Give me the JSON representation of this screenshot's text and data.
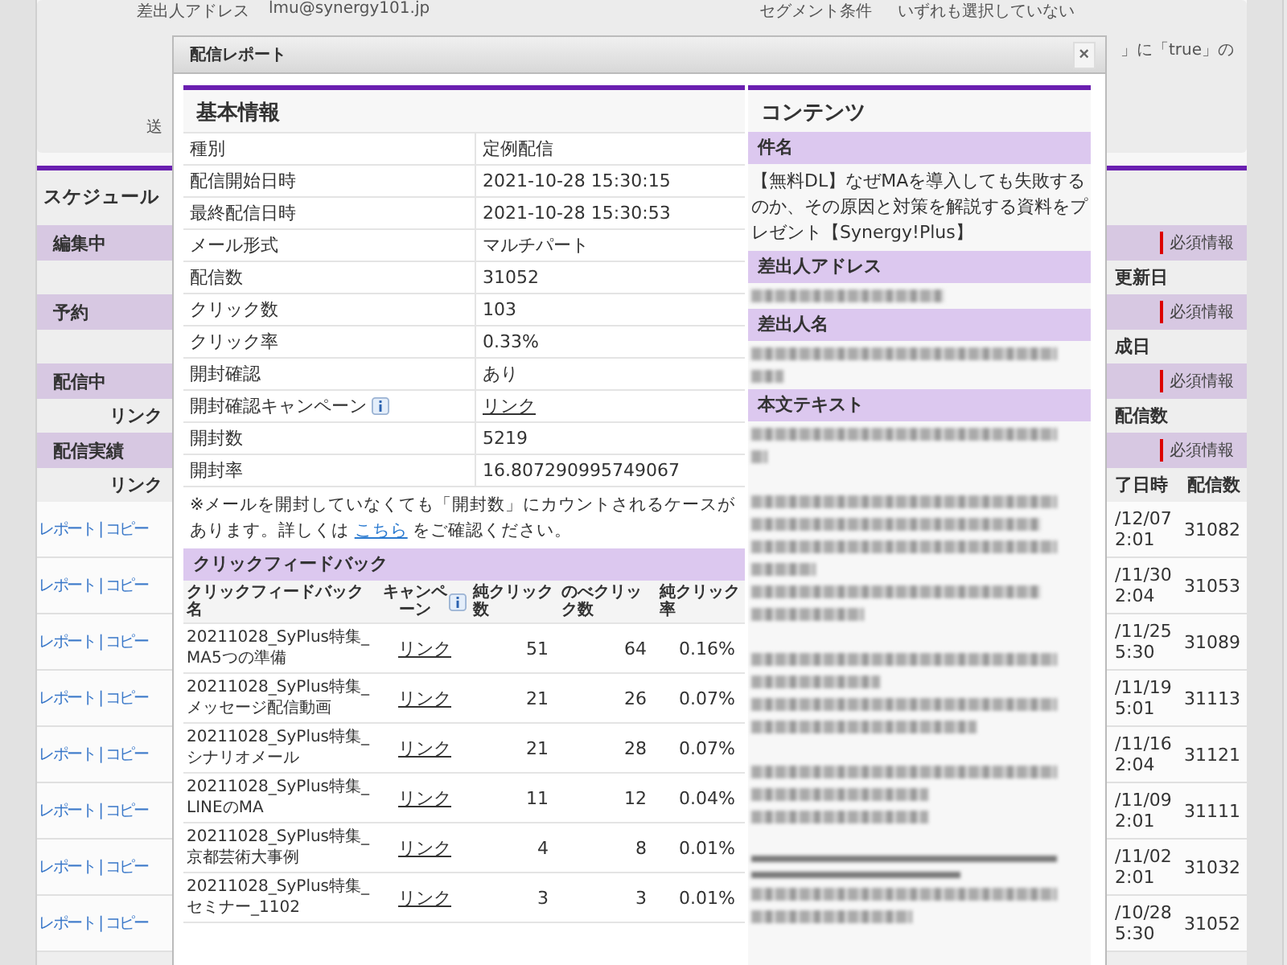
{
  "background": {
    "header_fields": [
      {
        "label": "差出人アドレス",
        "value": "lmu@synergy101.jp"
      },
      {
        "label": "セグメント条件",
        "value": "いずれも選択していない"
      }
    ],
    "condition_fragment": "」に「true」の",
    "label_fragment": "送",
    "schedule": {
      "title": "スケジュール",
      "sections": [
        {
          "name": "編集中",
          "badge": "必須情報",
          "header": {
            "date": "更新日"
          }
        },
        {
          "name": "予約",
          "badge": "必須情報",
          "header": {
            "date": "成日"
          }
        },
        {
          "name": "配信中",
          "badge": "必須情報",
          "header": {
            "left": "リンク",
            "date": "配信数"
          }
        },
        {
          "name": "配信実績",
          "badge": "必須情報",
          "header": {
            "left": "リンク",
            "date": "了日時",
            "count": "配信数"
          },
          "rows": [
            {
              "link": "レポート | コピー",
              "date": "/12/07",
              "time": "2:01",
              "count": "31082"
            },
            {
              "link": "レポート | コピー",
              "date": "/11/30",
              "time": "2:04",
              "count": "31053"
            },
            {
              "link": "レポート | コピー",
              "date": "/11/25",
              "time": "5:30",
              "count": "31089"
            },
            {
              "link": "レポート | コピー",
              "date": "/11/19",
              "time": "5:01",
              "count": "31113"
            },
            {
              "link": "レポート | コピー",
              "date": "/11/16",
              "time": "2:04",
              "count": "31121"
            },
            {
              "link": "レポート | コピー",
              "date": "/11/09",
              "time": "2:01",
              "count": "31111"
            },
            {
              "link": "レポート | コピー",
              "date": "/11/02",
              "time": "2:01",
              "count": "31032"
            },
            {
              "link": "レポート | コピー",
              "date": "/10/28",
              "time": "5:30",
              "count": "31052"
            }
          ]
        }
      ]
    }
  },
  "modal": {
    "title": "配信レポート",
    "close": "×",
    "basic": {
      "title": "基本情報",
      "rows": [
        {
          "label": "種別",
          "value": "定例配信",
          "kind": "text",
          "info": false
        },
        {
          "label": "配信開始日時",
          "value": "2021-10-28 15:30:15",
          "kind": "text",
          "info": false
        },
        {
          "label": "最終配信日時",
          "value": "2021-10-28 15:30:53",
          "kind": "text",
          "info": false
        },
        {
          "label": "メール形式",
          "value": "マルチパート",
          "kind": "text",
          "info": false
        },
        {
          "label": "配信数",
          "value": "31052",
          "kind": "text",
          "info": false
        },
        {
          "label": "クリック数",
          "value": "103",
          "kind": "text",
          "info": false
        },
        {
          "label": "クリック率",
          "value": "0.33%",
          "kind": "text",
          "info": false
        },
        {
          "label": "開封確認",
          "value": "あり",
          "kind": "text",
          "info": false
        },
        {
          "label": "開封確認キャンペーン",
          "value": "リンク",
          "kind": "link",
          "info": true
        },
        {
          "label": "開封数",
          "value": "5219",
          "kind": "text",
          "info": false
        },
        {
          "label": "開封率",
          "value": "16.807290995749067",
          "kind": "text",
          "info": false
        }
      ],
      "note": "※メールを開封していなくても「開封数」にカウントされるケースがあります。詳しくは",
      "note_link": "こちら",
      "note_end": "をご確認ください。"
    },
    "click_feedback": {
      "title": "クリックフィードバック",
      "columns": [
        {
          "label": "クリックフィードバック名",
          "info": false
        },
        {
          "label": "キャンペーン",
          "info": true
        },
        {
          "label": "純クリック数",
          "info": false
        },
        {
          "label": "のべクリック数",
          "info": false
        },
        {
          "label": "純クリック率",
          "info": false
        }
      ],
      "rows": [
        {
          "name": "20211028_SyPlus特集_MA5つの準備",
          "campaign": "リンク",
          "unique": "51",
          "total": "64",
          "rate": "0.16%"
        },
        {
          "name": "20211028_SyPlus特集_メッセージ配信動画",
          "campaign": "リンク",
          "unique": "21",
          "total": "26",
          "rate": "0.07%"
        },
        {
          "name": "20211028_SyPlus特集_シナリオメール",
          "campaign": "リンク",
          "unique": "21",
          "total": "28",
          "rate": "0.07%"
        },
        {
          "name": "20211028_SyPlus特集_LINEのMA",
          "campaign": "リンク",
          "unique": "11",
          "total": "12",
          "rate": "0.04%"
        },
        {
          "name": "20211028_SyPlus特集_京都芸術大事例",
          "campaign": "リンク",
          "unique": "4",
          "total": "8",
          "rate": "0.01%"
        },
        {
          "name": "20211028_SyPlus特集_セミナー_1102",
          "campaign": "リンク",
          "unique": "3",
          "total": "3",
          "rate": "0.01%"
        }
      ]
    },
    "contents": {
      "title": "コンテンツ",
      "sections": [
        {
          "heading": "件名",
          "kind": "text",
          "text": "【無料DL】なぜMAを導入しても失敗するのか、その原因と対策を解説する資料をプレゼント【Synergy!Plus】"
        },
        {
          "heading": "差出人アドレス",
          "kind": "blurred"
        },
        {
          "heading": "差出人名",
          "kind": "blurred"
        },
        {
          "heading": "本文テキスト",
          "kind": "blurred"
        }
      ]
    }
  }
}
